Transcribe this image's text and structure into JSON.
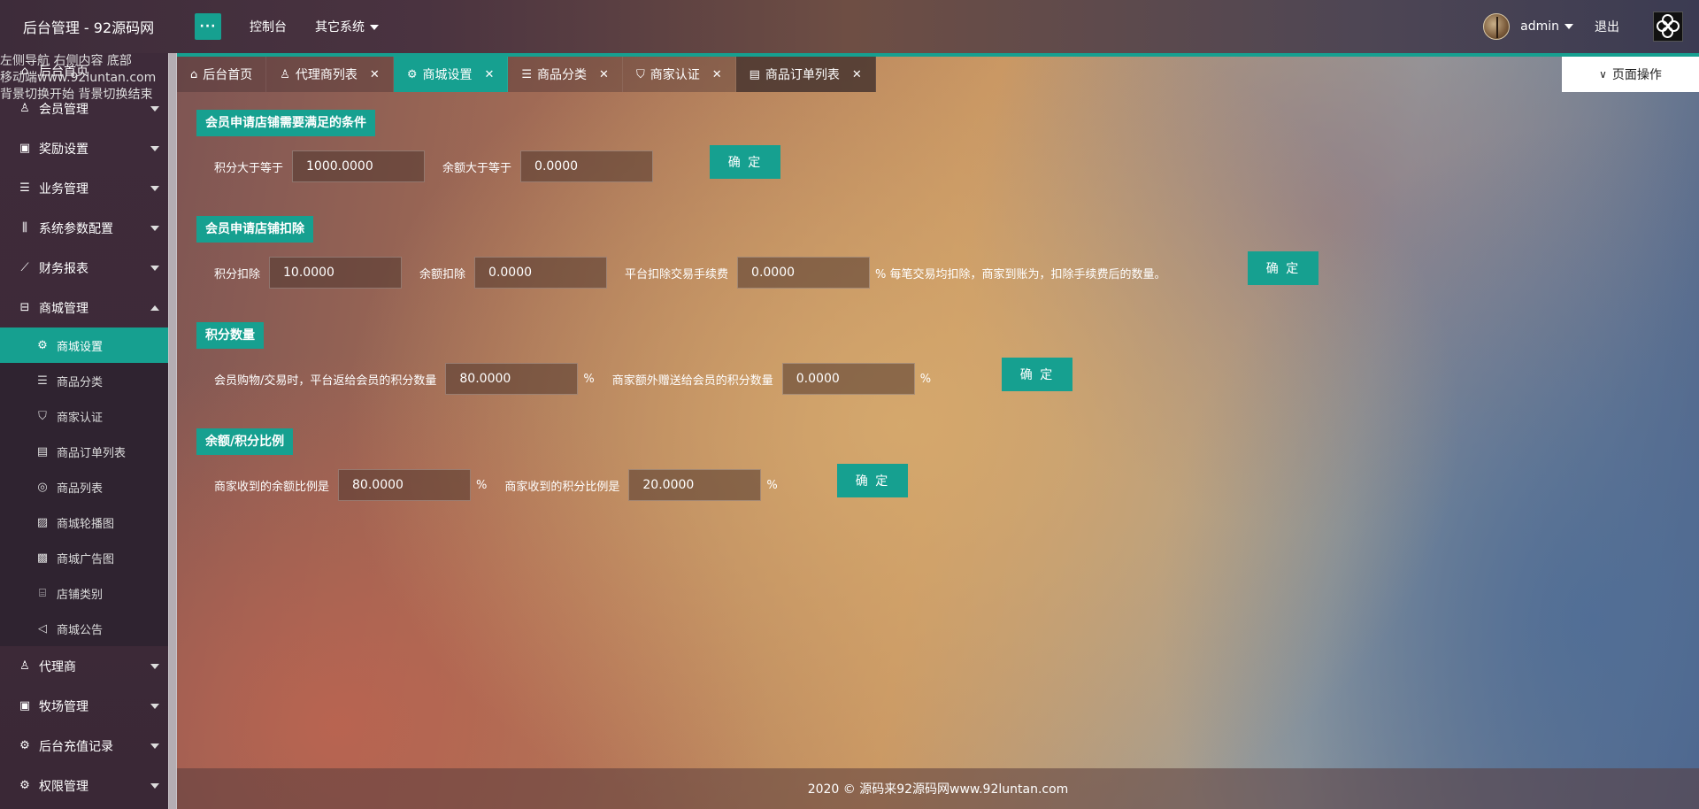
{
  "header": {
    "title": "后台管理 - 92源码网",
    "toggle_label": "···",
    "nav": [
      "控制台",
      "其它系统"
    ],
    "user": "admin",
    "logout": "退出"
  },
  "overlay_text": [
    "左侧导航 右侧内容 底部",
    "移动端www.92luntan.com",
    "背景切换开始 背景切换结束"
  ],
  "sidebar": {
    "items": [
      {
        "label": "后台首页",
        "icon": "home-icon"
      },
      {
        "label": "会员管理",
        "icon": "user-icon"
      },
      {
        "label": "奖励设置",
        "icon": "gift-icon"
      },
      {
        "label": "业务管理",
        "icon": "list-icon"
      },
      {
        "label": "系统参数配置",
        "icon": "sliders-icon"
      },
      {
        "label": "财务报表",
        "icon": "chart-icon"
      },
      {
        "label": "商城管理",
        "icon": "shop-icon"
      }
    ],
    "sub_items": [
      {
        "label": "商城设置",
        "icon": "gear-icon"
      },
      {
        "label": "商品分类",
        "icon": "list-icon"
      },
      {
        "label": "商家认证",
        "icon": "shield-icon"
      },
      {
        "label": "商品订单列表",
        "icon": "document-icon"
      },
      {
        "label": "商品列表",
        "icon": "circle-icon"
      },
      {
        "label": "商城轮播图",
        "icon": "image-icon"
      },
      {
        "label": "商城广告图",
        "icon": "picture-icon"
      },
      {
        "label": "店铺类别",
        "icon": "store-icon"
      },
      {
        "label": "商城公告",
        "icon": "speaker-icon"
      }
    ],
    "bottom_items": [
      {
        "label": "代理商",
        "icon": "user-icon"
      },
      {
        "label": "牧场管理",
        "icon": "gift-icon"
      },
      {
        "label": "后台充值记录",
        "icon": "gear-icon"
      },
      {
        "label": "权限管理",
        "icon": "gear-icon"
      }
    ]
  },
  "tabs": [
    {
      "label": "后台首页",
      "icon": "home-icon"
    },
    {
      "label": "代理商列表",
      "icon": "user-icon"
    },
    {
      "label": "商城设置",
      "icon": "gear-icon"
    },
    {
      "label": "商品分类",
      "icon": "list-icon"
    },
    {
      "label": "商家认证",
      "icon": "shield-icon"
    },
    {
      "label": "商品订单列表",
      "icon": "document-icon"
    }
  ],
  "page_ops": "页面操作",
  "sections": {
    "s1": {
      "title": "会员申请店铺需要满足的条件",
      "label1": "积分大于等于",
      "value1": "1000.0000",
      "label2": "余额大于等于",
      "value2": "0.0000"
    },
    "s2": {
      "title": "会员申请店铺扣除",
      "label1": "积分扣除",
      "value1": "10.0000",
      "label2": "余额扣除",
      "value2": "0.0000",
      "label3": "平台扣除交易手续费",
      "value3": "0.0000",
      "note": "% 每笔交易均扣除，商家到账为，扣除手续费后的数量。"
    },
    "s3": {
      "title": "积分数量",
      "label1": "会员购物/交易时，平台返给会员的积分数量",
      "value1": "80.0000",
      "label2": "商家额外赠送给会员的积分数量",
      "value2": "0.0000",
      "unit": "%"
    },
    "s4": {
      "title": "余额/积分比例",
      "label1": "商家收到的余额比例是",
      "value1": "80.0000",
      "label2": "商家收到的积分比例是",
      "value2": "20.0000",
      "unit": "%"
    }
  },
  "confirm_label": "确 定",
  "footer": "2020 © 源码来92源码网www.92luntan.com"
}
